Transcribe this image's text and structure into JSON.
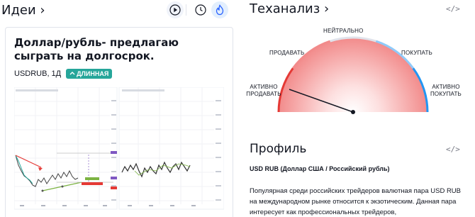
{
  "ideas": {
    "title": "Идеи ›",
    "card": {
      "title": "Доллар/рубль- предлагаю сыграть на долгосрок.",
      "symbol_timeframe": "USDRUB, 1Д",
      "badge": "ДЛИННАЯ"
    }
  },
  "technical": {
    "title": "Теханализ ›",
    "gauge_labels": {
      "neutral": "НЕЙТРАЛЬНО",
      "sell": "ПРОДАВАТЬ",
      "buy": "ПОКУПАТЬ",
      "strong_sell": "АКТИВНО ПРОДАВАТЬ",
      "strong_buy": "АКТИВНО ПОКУПАТЬ"
    },
    "needle_reading": "strong sell"
  },
  "profile": {
    "title": "Профиль",
    "subtitle": "USD RUB (Доллар США / Российский рубль)",
    "description": "Популярная среди российских трейдеров валютная пара USD RUB на международном рынке относится к экзотическим. Данная пара интересует как профессиональных трейдеров,"
  },
  "icons": {
    "play": "play-icon",
    "recent": "clock-icon",
    "popular": "flame-icon",
    "embed": "code-icon"
  },
  "colors": {
    "accent": "#2962ff",
    "long": "#26a69a",
    "sell": "#f44336",
    "buy": "#2196f3"
  }
}
